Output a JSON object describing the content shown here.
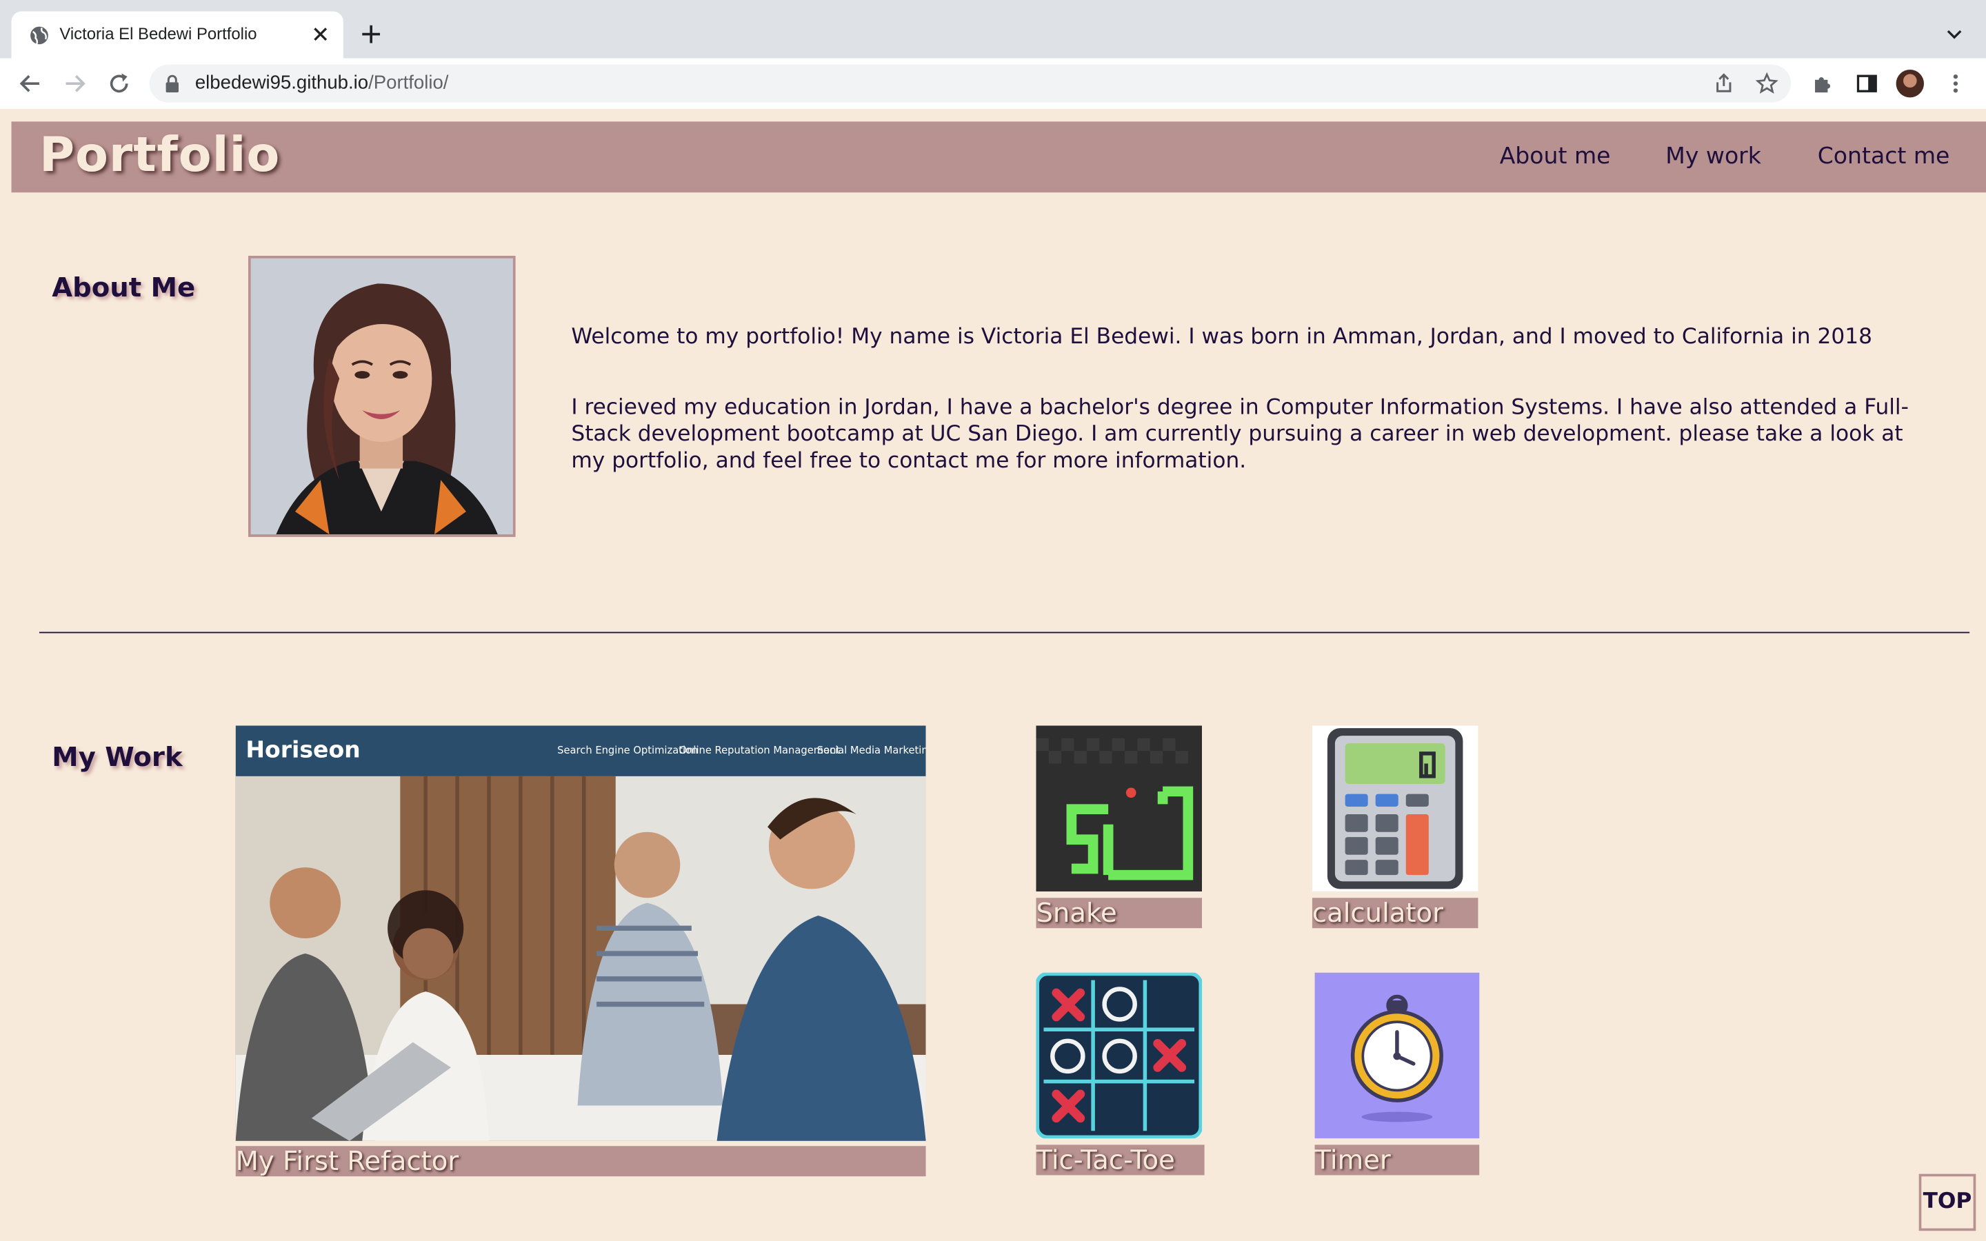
{
  "browser": {
    "tab_title": "Victoria El Bedewi Portfolio",
    "url_domain": "elbedewi95.github.io",
    "url_path": "/Portfolio/"
  },
  "header": {
    "brand": "Portfolio",
    "nav": [
      {
        "label": "About me"
      },
      {
        "label": "My work"
      },
      {
        "label": "Contact me"
      }
    ]
  },
  "about": {
    "title": "About Me",
    "paragraph1": "Welcome to my portfolio! My name is Victoria El Bedewi. I was born in Amman, Jordan, and I moved to California in 2018",
    "paragraph2": "I recieved my education in Jordan, I have a bachelor's degree in Computer Information Systems. I have also attended a Full-Stack development bootcamp at UC San Diego. I am currently pursuing a career in web development. please take a look at my portfolio, and feel free to contact me for more information."
  },
  "work": {
    "title": "My Work",
    "projects": [
      {
        "caption": "My First Refactor"
      },
      {
        "caption": "Snake"
      },
      {
        "caption": "calculator"
      },
      {
        "caption": "Tic-Tac-Toe"
      },
      {
        "caption": "Timer"
      }
    ],
    "horiseon": {
      "logo": "Horiseon",
      "nav": [
        "Search Engine Optimization",
        "Online Reputation Management",
        "Social Media Marketing"
      ]
    }
  },
  "top_button": "TOP",
  "colors": {
    "page_bg": "#f7eada",
    "accent": "#b89290",
    "text": "#1e0f3c"
  }
}
